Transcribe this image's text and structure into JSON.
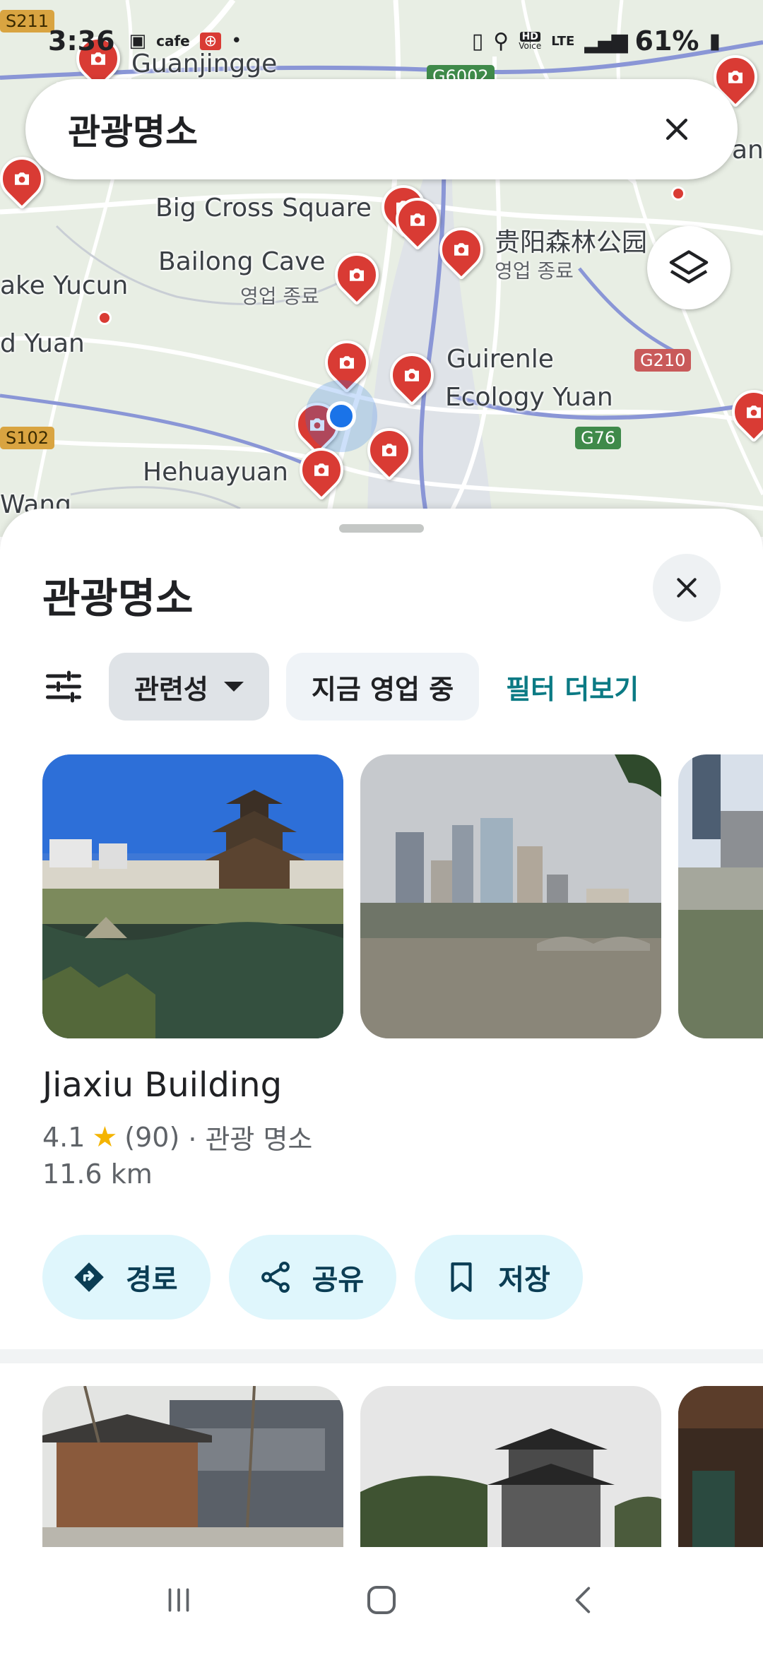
{
  "status_bar": {
    "time": "3:36",
    "app_label": "cafe",
    "network_hd": "HD",
    "network_voice": "Voice",
    "network_lte": "LTE",
    "battery": "61%"
  },
  "search": {
    "query": "관광명소"
  },
  "map": {
    "labels": {
      "guanjingge": "Guanjingge",
      "big_cross_square": "Big Cross Square",
      "bailong_cave": "Bailong Cave",
      "bailong_status": "영업 종료",
      "forest_park": "贵阳森林公园",
      "forest_status": "영업 종료",
      "yucun": "ake Yucun",
      "d_yuan": "d Yuan",
      "guirenle": "Guirenle",
      "ecology_yuan": "Ecology Yuan",
      "hehuayuan": "Hehuayuan",
      "wang": "Wang",
      "edge_ang": "ang"
    },
    "shields": {
      "s211": "S211",
      "g6002": "G6002",
      "g210": "G210",
      "g76": "G76",
      "s102": "S102"
    }
  },
  "sheet": {
    "title": "관광명소",
    "filters": {
      "relevance": "관련성",
      "open_now": "지금 영업 중",
      "more": "필터 더보기"
    },
    "place": {
      "name": "Jiaxiu Building",
      "rating": "4.1",
      "reviews": "(90)",
      "category": "· 관광 명소",
      "distance": "11.6 km"
    },
    "actions": {
      "directions": "경로",
      "share": "공유",
      "save": "저장"
    }
  },
  "colors": {
    "pin": "#d93b34",
    "action_bg": "#dff6fc",
    "link": "#0b7a84",
    "star": "#f4b400"
  }
}
